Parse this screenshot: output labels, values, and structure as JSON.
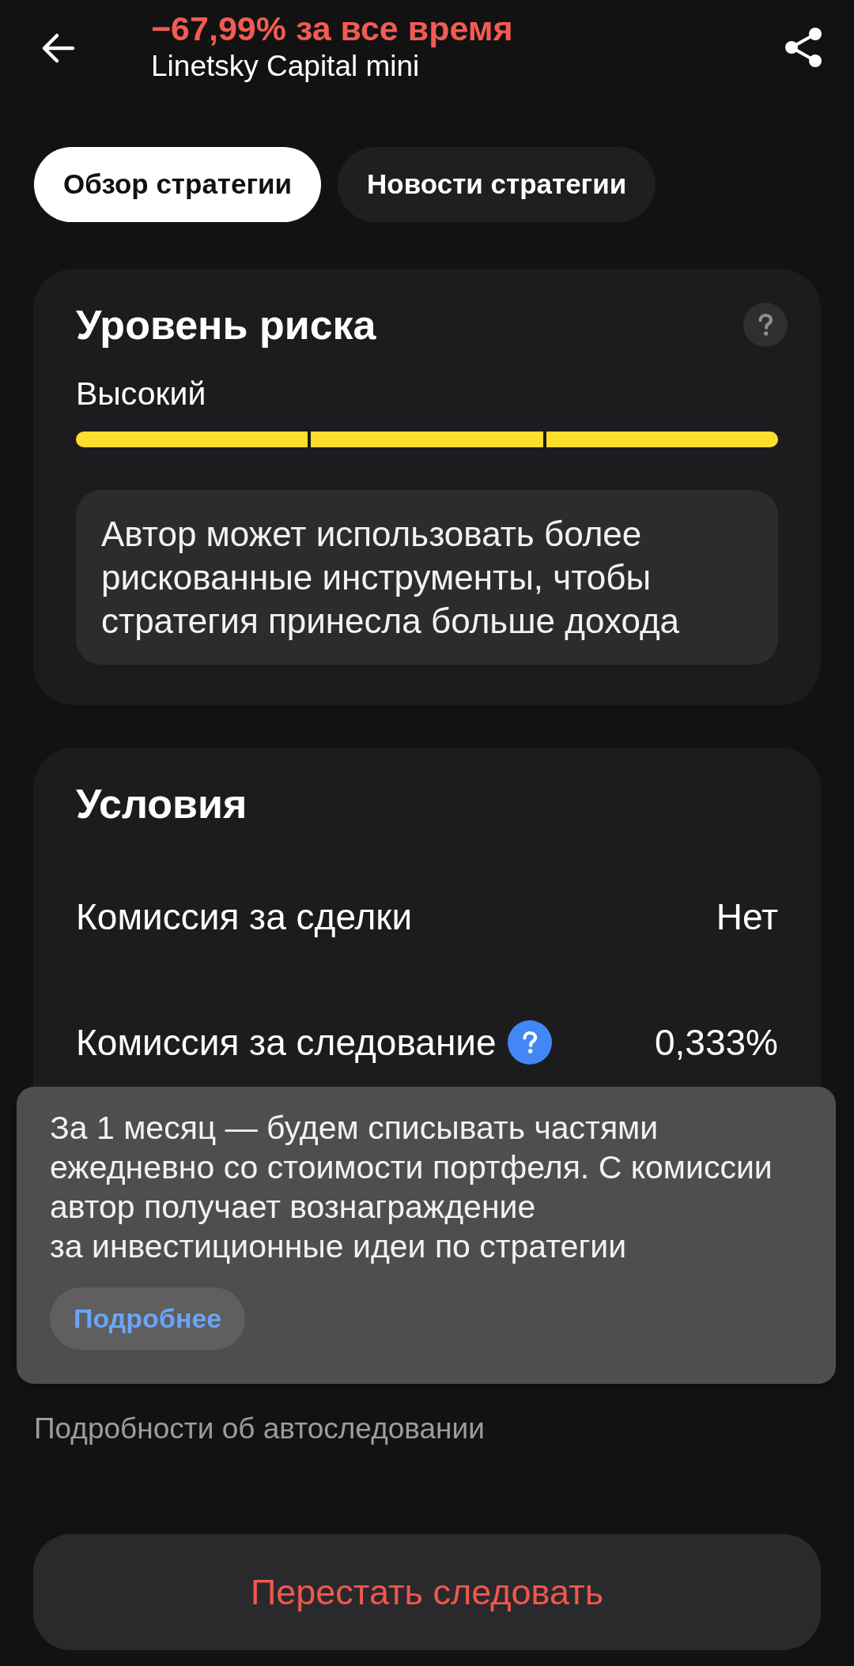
{
  "header": {
    "return_text": "−67,99% за все время",
    "strategy_name": "Linetsky Capital mini"
  },
  "tabs": [
    {
      "label": "Обзор стратегии",
      "selected": true
    },
    {
      "label": "Новости стратегии",
      "selected": false
    }
  ],
  "risk_card": {
    "title": "Уровень риска",
    "level_label": "Высокий",
    "segments": [
      {
        "filled": true
      },
      {
        "filled": true
      },
      {
        "filled": true
      }
    ],
    "description": "Автор может использовать более рискованные инструменты, чтобы стратегия принесла больше дохода"
  },
  "conditions_card": {
    "title": "Условия",
    "rows": [
      {
        "label": "Комиссия за сделки",
        "value": "Нет",
        "has_help": false
      },
      {
        "label": "Комиссия за следование",
        "value": "0,333%",
        "has_help": true
      }
    ]
  },
  "tooltip": {
    "text": "За 1 месяц — будем списывать частями ежедневно со стоимости портфеля. С комиссии автор получает вознаграждение\nза инвестиционные идеи по стратегии",
    "button": "Подробнее"
  },
  "details_link": "Подробности об автоследовании",
  "unfollow_button": "Перестать следовать"
}
